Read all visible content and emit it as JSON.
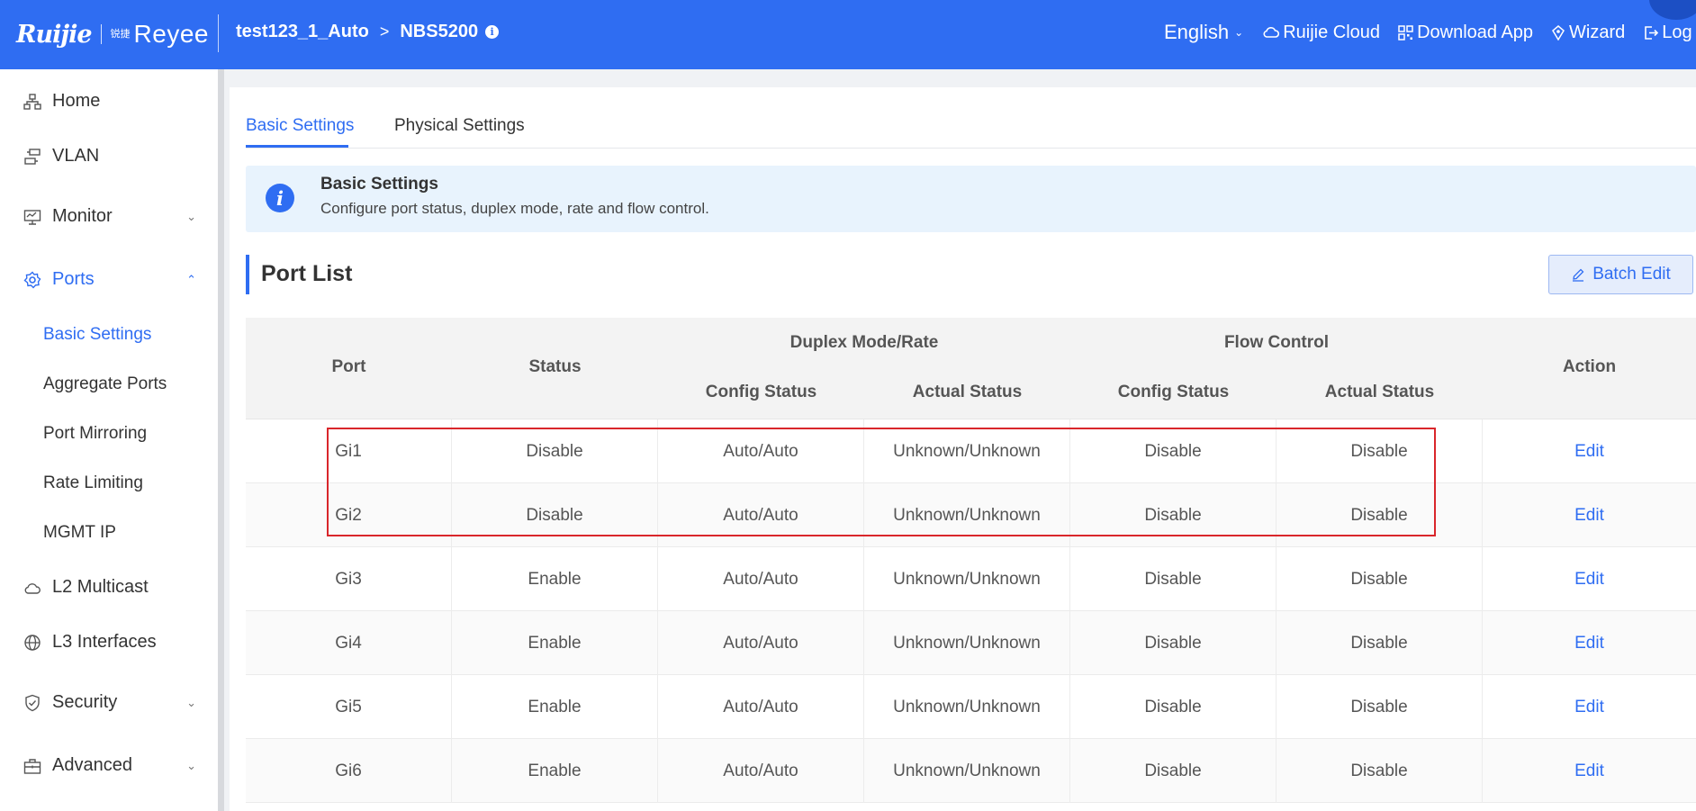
{
  "header": {
    "logo_ruijie": "Ruijie",
    "logo_reyee_cn": "锐捷",
    "logo_reyee": "Reyee",
    "breadcrumb_project": "test123_1_Auto",
    "breadcrumb_arrow": ">",
    "breadcrumb_device": "NBS5200",
    "language": "English",
    "ruijie_cloud": "Ruijie Cloud",
    "download_app": "Download App",
    "wizard": "Wizard",
    "logout": "Log Out"
  },
  "sidebar": {
    "items": [
      {
        "label": "Home",
        "icon": "home-network-icon"
      },
      {
        "label": "VLAN",
        "icon": "vlan-icon"
      },
      {
        "label": "Monitor",
        "icon": "monitor-icon"
      },
      {
        "label": "Ports",
        "icon": "gear-icon"
      },
      {
        "label": "L2 Multicast",
        "icon": "cloud-icon"
      },
      {
        "label": "L3 Interfaces",
        "icon": "globe-icon"
      },
      {
        "label": "Security",
        "icon": "shield-icon"
      },
      {
        "label": "Advanced",
        "icon": "toolbox-icon"
      }
    ],
    "ports_sub": [
      "Basic Settings",
      "Aggregate Ports",
      "Port Mirroring",
      "Rate Limiting",
      "MGMT IP"
    ]
  },
  "tabs": [
    "Basic Settings",
    "Physical Settings"
  ],
  "alert": {
    "title": "Basic Settings",
    "description": "Configure port status, duplex mode, rate and flow control."
  },
  "section_title": "Port List",
  "batch_edit": "Batch Edit",
  "table": {
    "headers": {
      "port": "Port",
      "status": "Status",
      "duplex_group": "Duplex Mode/Rate",
      "flow_group": "Flow Control",
      "config_status": "Config Status",
      "actual_status": "Actual Status",
      "action": "Action"
    },
    "rows": [
      {
        "port": "Gi1",
        "status": "Disable",
        "duplex_config": "Auto/Auto",
        "duplex_actual": "Unknown/Unknown",
        "flow_config": "Disable",
        "flow_actual": "Disable",
        "action": "Edit"
      },
      {
        "port": "Gi2",
        "status": "Disable",
        "duplex_config": "Auto/Auto",
        "duplex_actual": "Unknown/Unknown",
        "flow_config": "Disable",
        "flow_actual": "Disable",
        "action": "Edit"
      },
      {
        "port": "Gi3",
        "status": "Enable",
        "duplex_config": "Auto/Auto",
        "duplex_actual": "Unknown/Unknown",
        "flow_config": "Disable",
        "flow_actual": "Disable",
        "action": "Edit"
      },
      {
        "port": "Gi4",
        "status": "Enable",
        "duplex_config": "Auto/Auto",
        "duplex_actual": "Unknown/Unknown",
        "flow_config": "Disable",
        "flow_actual": "Disable",
        "action": "Edit"
      },
      {
        "port": "Gi5",
        "status": "Enable",
        "duplex_config": "Auto/Auto",
        "duplex_actual": "Unknown/Unknown",
        "flow_config": "Disable",
        "flow_actual": "Disable",
        "action": "Edit"
      },
      {
        "port": "Gi6",
        "status": "Enable",
        "duplex_config": "Auto/Auto",
        "duplex_actual": "Unknown/Unknown",
        "flow_config": "Disable",
        "flow_actual": "Disable",
        "action": "Edit"
      }
    ]
  },
  "colors": {
    "brand": "#2f6df2",
    "highlight": "#d9262b"
  }
}
